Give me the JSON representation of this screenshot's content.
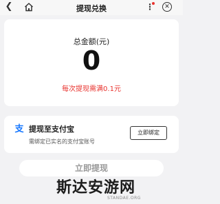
{
  "header": {
    "back_icon": "chevron-left-icon",
    "home_icon": "home-icon",
    "title": "提现兑换",
    "more_icon": "more-vertical-icon",
    "close_icon": "close-circle-icon"
  },
  "summary": {
    "total_label": "总金额(元)",
    "total_amount": "0",
    "min_note": "每次提现需满0.1元"
  },
  "payment": {
    "icon": "alipay-icon",
    "title": "提现至支付宝",
    "hint": "需绑定已实名的支付宝账号",
    "bind_button": "立即绑定"
  },
  "action": {
    "withdraw_button": "立即提现"
  },
  "watermark": {
    "text": "斯达安游网",
    "url": "STANDAE.ORG"
  },
  "colors": {
    "accent_red": "#e8322d",
    "alipay_blue": "#1677ff",
    "page_bg": "#f2f2f4"
  }
}
